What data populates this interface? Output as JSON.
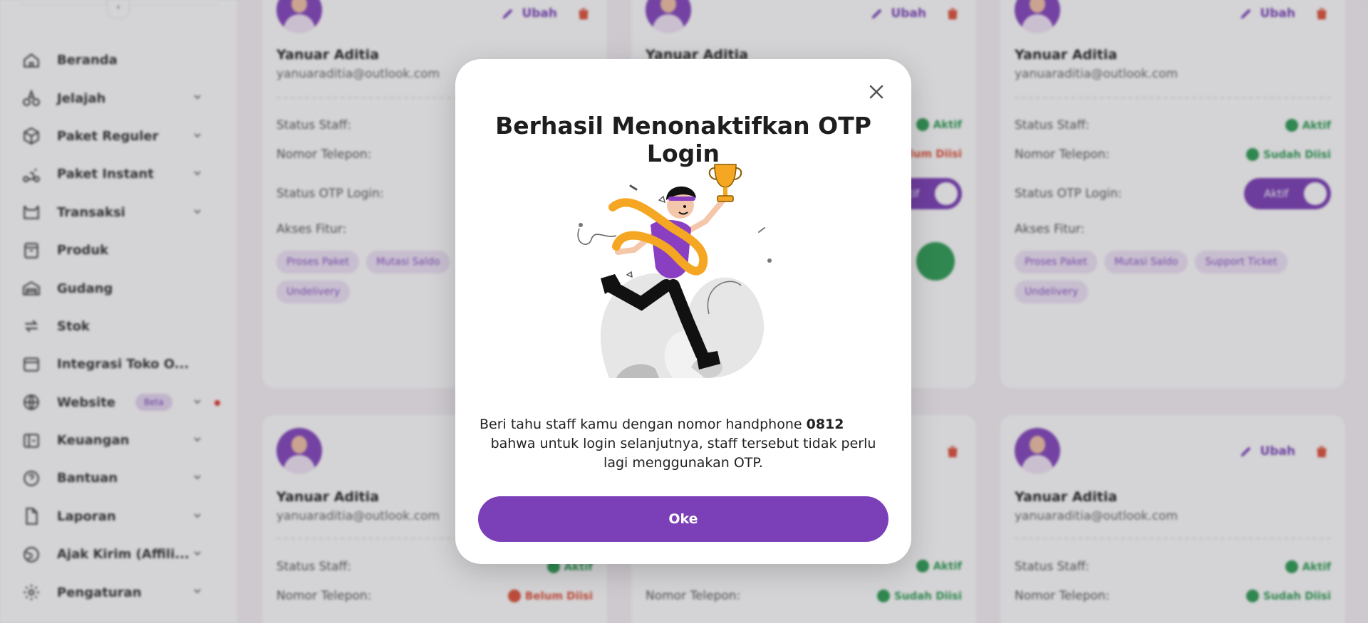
{
  "sidebar": {
    "items": [
      {
        "label": "Beranda",
        "icon": "home-icon",
        "chevron": false
      },
      {
        "label": "Jelajah",
        "icon": "explore-icon",
        "chevron": true
      },
      {
        "label": "Paket Reguler",
        "icon": "package-icon",
        "chevron": true
      },
      {
        "label": "Paket Instant",
        "icon": "scooter-icon",
        "chevron": true
      },
      {
        "label": "Transaksi",
        "icon": "cart-icon",
        "chevron": true
      },
      {
        "label": "Produk",
        "icon": "box-icon",
        "chevron": false
      },
      {
        "label": "Gudang",
        "icon": "warehouse-icon",
        "chevron": false
      },
      {
        "label": "Stok",
        "icon": "transfer-icon",
        "chevron": false
      },
      {
        "label": "Integrasi Toko O...",
        "icon": "store-icon",
        "chevron": false
      },
      {
        "label": "Website",
        "icon": "globe-icon",
        "chevron": true,
        "badge": "Beta",
        "dot": true
      },
      {
        "label": "Keuangan",
        "icon": "wallet-icon",
        "chevron": true
      },
      {
        "label": "Bantuan",
        "icon": "help-icon",
        "chevron": true
      },
      {
        "label": "Laporan",
        "icon": "document-icon",
        "chevron": true
      },
      {
        "label": "Ajak Kirim (Affili...",
        "icon": "affiliate-icon",
        "chevron": true
      },
      {
        "label": "Pengaturan",
        "icon": "gear-icon",
        "chevron": true
      }
    ]
  },
  "cards": {
    "edit_label": "Ubah",
    "name": "Yanuar Aditia",
    "email": "yanuaraditia@outlook.com",
    "status_staff_label": "Status Staff:",
    "phone_label": "Nomor Telepon:",
    "otp_label": "Status OTP Login:",
    "features_label": "Akses Fitur:",
    "active": "Aktif",
    "filled": "Sudah Diisi",
    "not_filled": "Belum Diisi",
    "toggle_on": "Aktif",
    "chips": [
      "Proses Paket",
      "Mutasi Saldo",
      "Support Ticket",
      "Undelivery"
    ]
  },
  "modal": {
    "title": "Berhasil Menonaktifkan OTP Login",
    "desc_prefix": "Beri tahu staff kamu dengan nomor handphone ",
    "phone": "0812",
    "desc_rest": "bahwa untuk login selanjutnya, staff tersebut tidak perlu lagi menggunakan OTP.",
    "ok_label": "Oke"
  },
  "colors": {
    "primary": "#7B3FB8",
    "success": "#2E9E55",
    "danger": "#E0533B",
    "accent_orange": "#F5A623"
  }
}
